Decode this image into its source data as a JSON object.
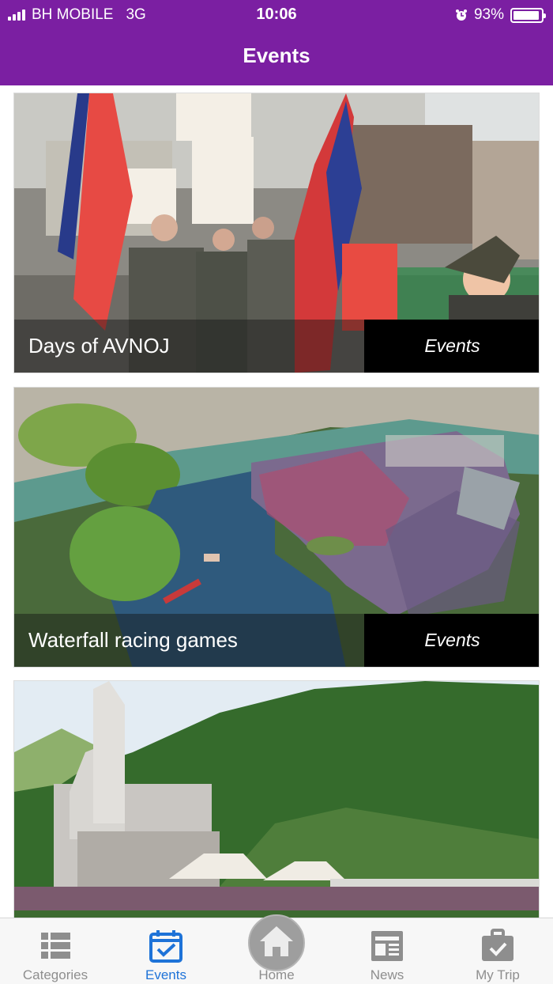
{
  "status": {
    "carrier": "BH MOBILE",
    "network": "3G",
    "time": "10:06",
    "battery_percent": "93%",
    "battery_level": 0.93
  },
  "header": {
    "title": "Events"
  },
  "colors": {
    "header": "#7b1fa2",
    "active_tab": "#1e73d8",
    "inactive_tab": "#8e8e8e"
  },
  "events": [
    {
      "title": "Days of AVNOJ",
      "category": "Events"
    },
    {
      "title": "Waterfall racing games",
      "category": "Events"
    },
    {
      "title": "",
      "category": ""
    }
  ],
  "tabs": [
    {
      "label": "Categories",
      "icon": "list-icon",
      "active": false
    },
    {
      "label": "Events",
      "icon": "calendar-check-icon",
      "active": true
    },
    {
      "label": "Home",
      "icon": "home-icon",
      "active": false
    },
    {
      "label": "News",
      "icon": "newspaper-icon",
      "active": false
    },
    {
      "label": "My Trip",
      "icon": "briefcase-check-icon",
      "active": false
    }
  ]
}
